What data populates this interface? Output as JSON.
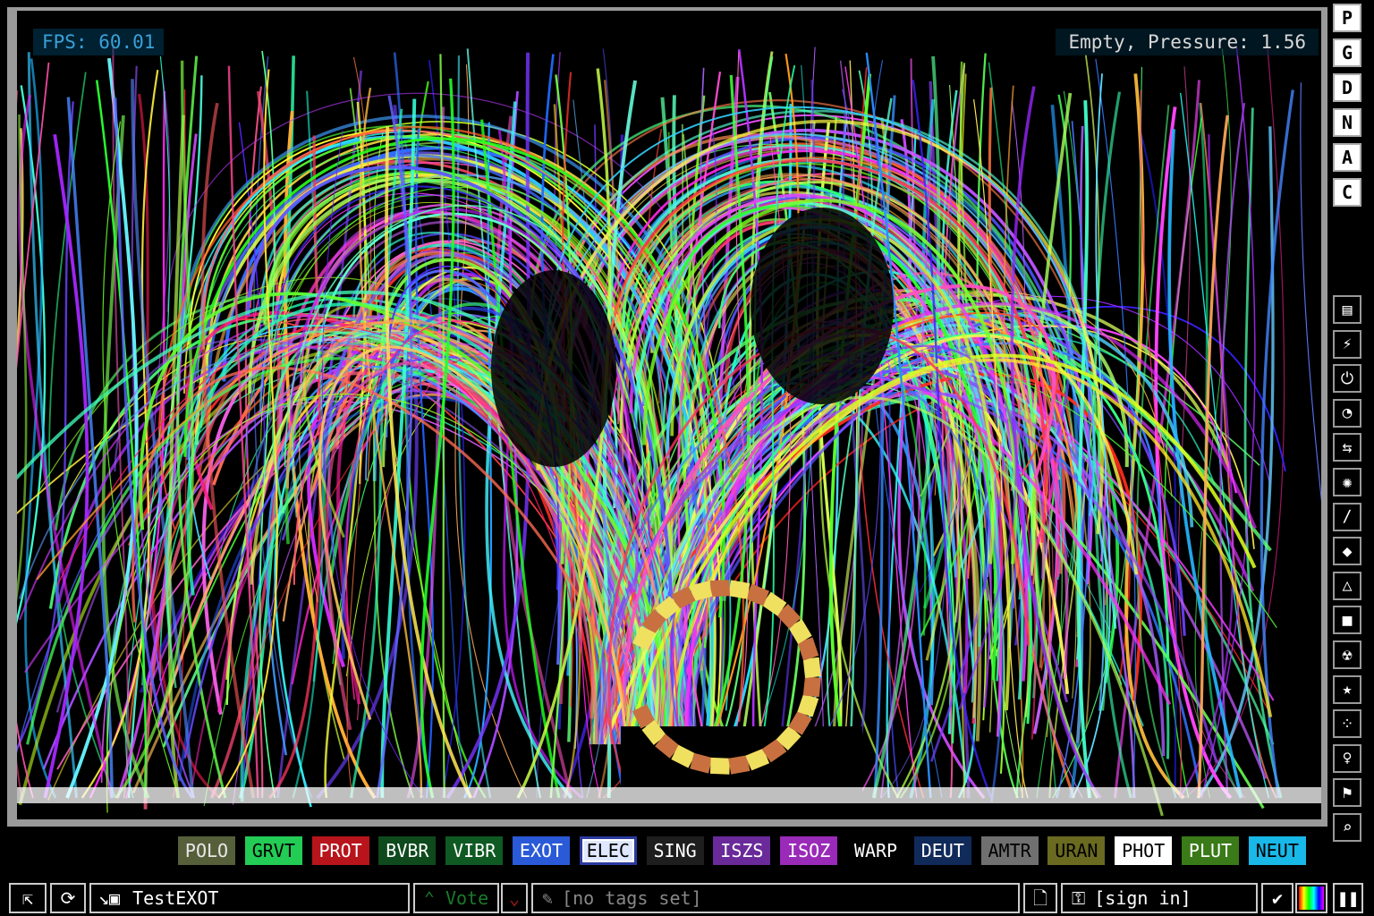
{
  "hud": {
    "fps": "FPS: 60.01",
    "status": "Empty, Pressure: 1.56"
  },
  "render_mode_buttons": [
    "P",
    "G",
    "D",
    "N",
    "A",
    "C"
  ],
  "category_icons": [
    "walls-icon",
    "electronics-icon",
    "powered-icon",
    "sensors-icon",
    "force-icon",
    "explosives-icon",
    "gases-icon",
    "liquids-icon",
    "powders-icon",
    "solids-icon",
    "radioactive-icon",
    "special-icon",
    "particles-icon",
    "life-icon",
    "tools-icon",
    "search-icon"
  ],
  "elements": [
    {
      "label": "POLO",
      "bg": "#55603a",
      "fg": "#e8e8e8"
    },
    {
      "label": "GRVT",
      "bg": "#22cc55",
      "fg": "#000000"
    },
    {
      "label": "PROT",
      "bg": "#b8141c",
      "fg": "#ffffff"
    },
    {
      "label": "BVBR",
      "bg": "#0e4a1c",
      "fg": "#ffffff"
    },
    {
      "label": "VIBR",
      "bg": "#0f5a22",
      "fg": "#ffffff"
    },
    {
      "label": "EXOT",
      "bg": "#2a5ad8",
      "fg": "#ffffff"
    },
    {
      "label": "ELEC",
      "bg": "#dfe8ff",
      "fg": "#000000"
    },
    {
      "label": "SING",
      "bg": "#1e1e1e",
      "fg": "#ffffff"
    },
    {
      "label": "ISZS",
      "bg": "#6a2a9a",
      "fg": "#ffffff"
    },
    {
      "label": "ISOZ",
      "bg": "#9a2ab8",
      "fg": "#ffffff"
    },
    {
      "label": "WARP",
      "bg": "#000000",
      "fg": "#ffffff"
    },
    {
      "label": "DEUT",
      "bg": "#102a5a",
      "fg": "#ffffff"
    },
    {
      "label": "AMTR",
      "bg": "#707070",
      "fg": "#000000"
    },
    {
      "label": "URAN",
      "bg": "#6a6a20",
      "fg": "#000000"
    },
    {
      "label": "PHOT",
      "bg": "#ffffff",
      "fg": "#000000"
    },
    {
      "label": "PLUT",
      "bg": "#3a7a18",
      "fg": "#ffffff"
    },
    {
      "label": "NEUT",
      "bg": "#18b8e8",
      "fg": "#000000"
    }
  ],
  "bottom_bar": {
    "save_name": "TestEXOT",
    "vote_label": "Vote",
    "tags_placeholder": "[no tags set]",
    "signin_label": "[sign in]"
  },
  "colors": {
    "tube_a": "#f0e060",
    "tube_b": "#c87040"
  }
}
